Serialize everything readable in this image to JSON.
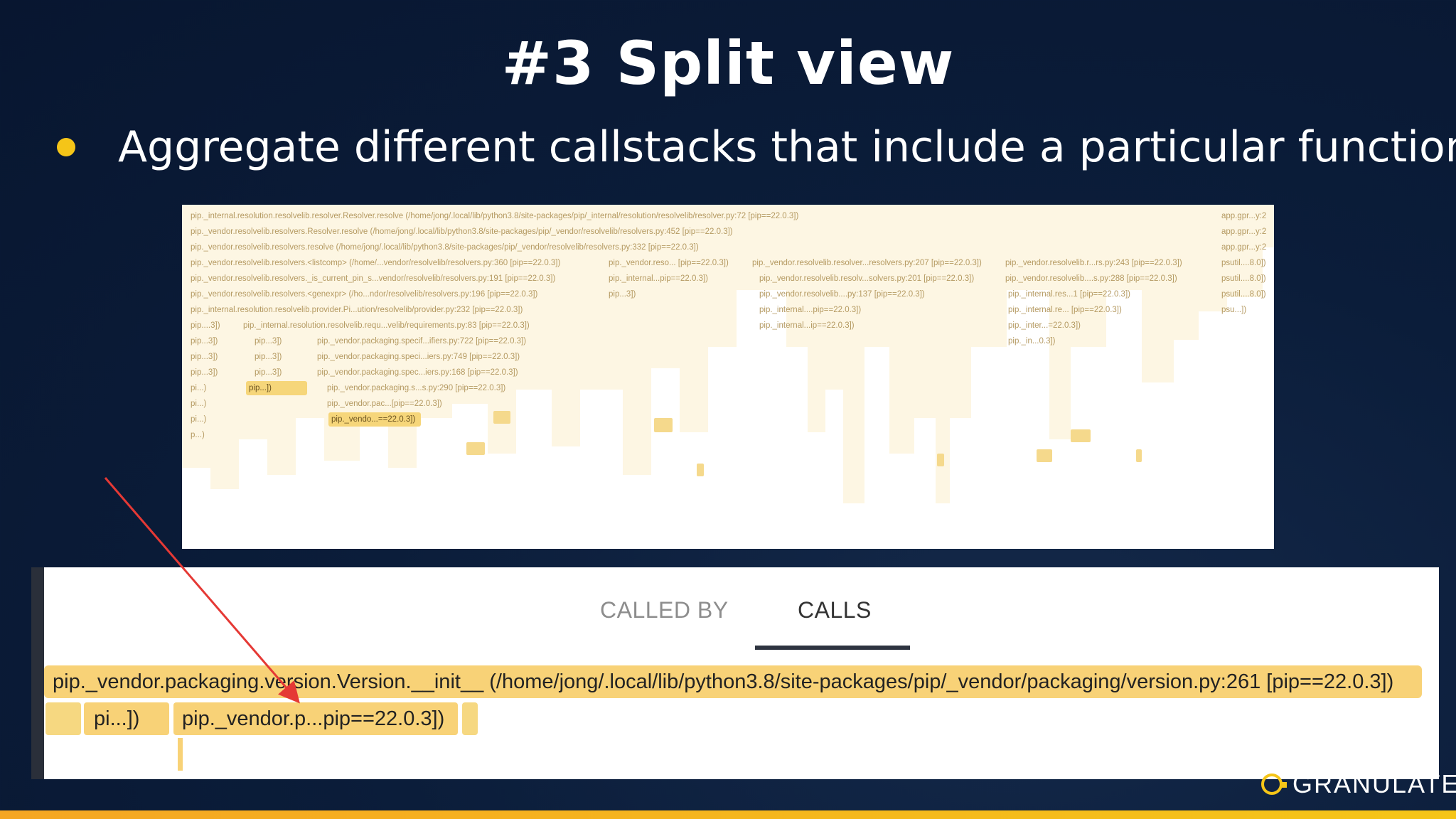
{
  "slide": {
    "title": "#3 Split view",
    "bullet": "Aggregate different callstacks that include a particular function"
  },
  "flamegraph": {
    "frames": [
      "pip._internal.resolution.resolvelib.resolver.Resolver.resolve (/home/jong/.local/lib/python3.8/site-packages/pip/_internal/resolution/resolvelib/resolver.py:72 [pip==22.0.3])",
      "pip._vendor.resolvelib.resolvers.Resolver.resolve (/home/jong/.local/lib/python3.8/site-packages/pip/_vendor/resolvelib/resolvers.py:452 [pip==22.0.3])",
      "pip._vendor.resolvelib.resolvers.resolve (/home/jong/.local/lib/python3.8/site-packages/pip/_vendor/resolvelib/resolvers.py:332 [pip==22.0.3])",
      "pip._vendor.resolvelib.resolvers.<listcomp> (/home/...vendor/resolvelib/resolvers.py:360 [pip==22.0.3])",
      "pip._vendor.resolvelib.resolvers._is_current_pin_s...vendor/resolvelib/resolvers.py:191 [pip==22.0.3])",
      "pip._vendor.resolvelib.resolvers.<genexpr> (/ho...ndor/resolvelib/resolvers.py:196 [pip==22.0.3])",
      "pip._internal.resolution.resolvelib.provider.Pi...ution/resolvelib/provider.py:232 [pip==22.0.3])"
    ],
    "row8": [
      "pip....3])",
      "pip._internal.resolution.resolvelib.requ...velib/requirements.py:83 [pip==22.0.3])"
    ],
    "col_left": [
      "pip...3])",
      "pip...3])",
      "pip...3])",
      "pi...)",
      "pi...)",
      "pi...)",
      "p...)"
    ],
    "col_second": [
      "pip...3])",
      "pip...3])",
      "pip...3])",
      "pip...])"
    ],
    "col_mid": [
      "pip._vendor.packaging.specif...ifiers.py:722 [pip==22.0.3])",
      "pip._vendor.packaging.speci...iers.py:749 [pip==22.0.3])",
      "pip._vendor.packaging.spec...iers.py:168 [pip==22.0.3])",
      "pip._vendor.packaging.s...s.py:290 [pip==22.0.3])",
      "pip._vendor.pac...[pip==22.0.3])"
    ],
    "highlight": "pip._vendo...==22.0.3])",
    "middle_top": [
      "pip._vendor.reso... [pip==22.0.3])",
      "pip._internal...pip==22.0.3])",
      "pip...3])"
    ],
    "right_top": [
      "pip._vendor.resolvelib.resolver...resolvers.py:207 [pip==22.0.3])",
      "pip._vendor.resolvelib.resolv...solvers.py:201 [pip==22.0.3])",
      "pip._vendor.resolvelib....py:137 [pip==22.0.3])",
      "pip._internal....pip==22.0.3])",
      "pip._internal...ip==22.0.3])"
    ],
    "far_right": [
      "pip._vendor.resolvelib.r...rs.py:243 [pip==22.0.3])",
      "pip._vendor.resolvelib....s.py:288 [pip==22.0.3])",
      "pip._internal.res...1 [pip==22.0.3])",
      "pip._internal.re... [pip==22.0.3])",
      "pip._inter...=22.0.3])",
      "pip._in...0.3])"
    ],
    "edge": [
      "app.gpr...y:2",
      "app.gpr...y:2",
      "app.gpr...y:2",
      "psutil....8.0])",
      "psutil....8.0])",
      "psutil....8.0])",
      "psu...])"
    ]
  },
  "split_view": {
    "tabs": [
      {
        "label": "CALLED BY",
        "active": false
      },
      {
        "label": "CALLS",
        "active": true
      }
    ],
    "root_call": "pip._vendor.packaging.version.Version.__init__ (/home/jong/.local/lib/python3.8/site-packages/pip/_vendor/packaging/version.py:261 [pip==22.0.3])",
    "children": [
      {
        "label": ""
      },
      {
        "label": "pi...])"
      },
      {
        "label": "pip._vendor.p...pip==22.0.3])"
      },
      {
        "label": ""
      }
    ]
  },
  "brand": {
    "name": "GRANULATE"
  },
  "colors": {
    "background": "#0b1d3a",
    "accent": "#f5c518",
    "frame": "#f8d277",
    "arrow": "#e53935"
  }
}
